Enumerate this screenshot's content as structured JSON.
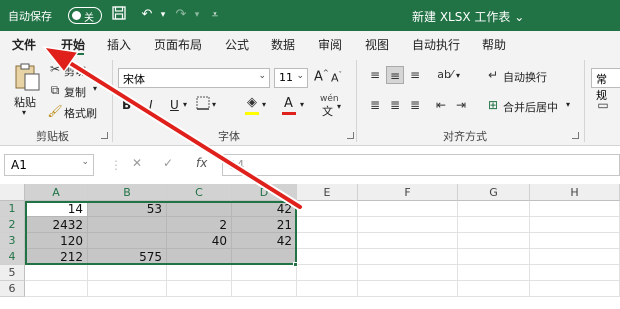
{
  "titlebar": {
    "autosave_label": "自动保存",
    "toggle_label": "关",
    "title": "新建 XLSX 工作表",
    "title_chevron": "⌄",
    "icons": [
      "save-icon",
      "undo-icon",
      "redo-icon",
      "customize-icon"
    ]
  },
  "tabs": [
    "文件",
    "开始",
    "插入",
    "页面布局",
    "公式",
    "数据",
    "审阅",
    "视图",
    "自动执行",
    "帮助"
  ],
  "active_tab": "开始",
  "ribbon": {
    "clipboard": {
      "paste_label": "粘贴",
      "cut_label": "剪切",
      "copy_label": "复制",
      "format_painter_label": "格式刷",
      "group_label": "剪贴板"
    },
    "font": {
      "font_name": "宋体",
      "font_size": "11",
      "bold": "B",
      "italic": "I",
      "underline": "U",
      "grow": "A",
      "shrink": "A",
      "color_letter": "A",
      "wen": "文",
      "group_label": "字体"
    },
    "alignment": {
      "wrap_label": "自动换行",
      "merge_label": "合并后居中",
      "group_label": "对齐方式"
    },
    "number": {
      "format_label": "常规"
    }
  },
  "formula_bar": {
    "name_box": "A1",
    "cancel": "✕",
    "enter": "✓",
    "fx": "fx",
    "value": "14"
  },
  "sheet": {
    "columns": [
      "A",
      "B",
      "C",
      "D",
      "E",
      "F",
      "G",
      "H"
    ],
    "rows": [
      "1",
      "2",
      "3",
      "4",
      "5",
      "6"
    ],
    "cells": [
      [
        "14",
        "53",
        "",
        "42"
      ],
      [
        "2432",
        "",
        "2",
        "21"
      ],
      [
        "120",
        "",
        "40",
        "42"
      ],
      [
        "212",
        "575",
        "",
        ""
      ]
    ]
  },
  "colors": {
    "brand": "#217346",
    "arrow": "#e0201b"
  }
}
